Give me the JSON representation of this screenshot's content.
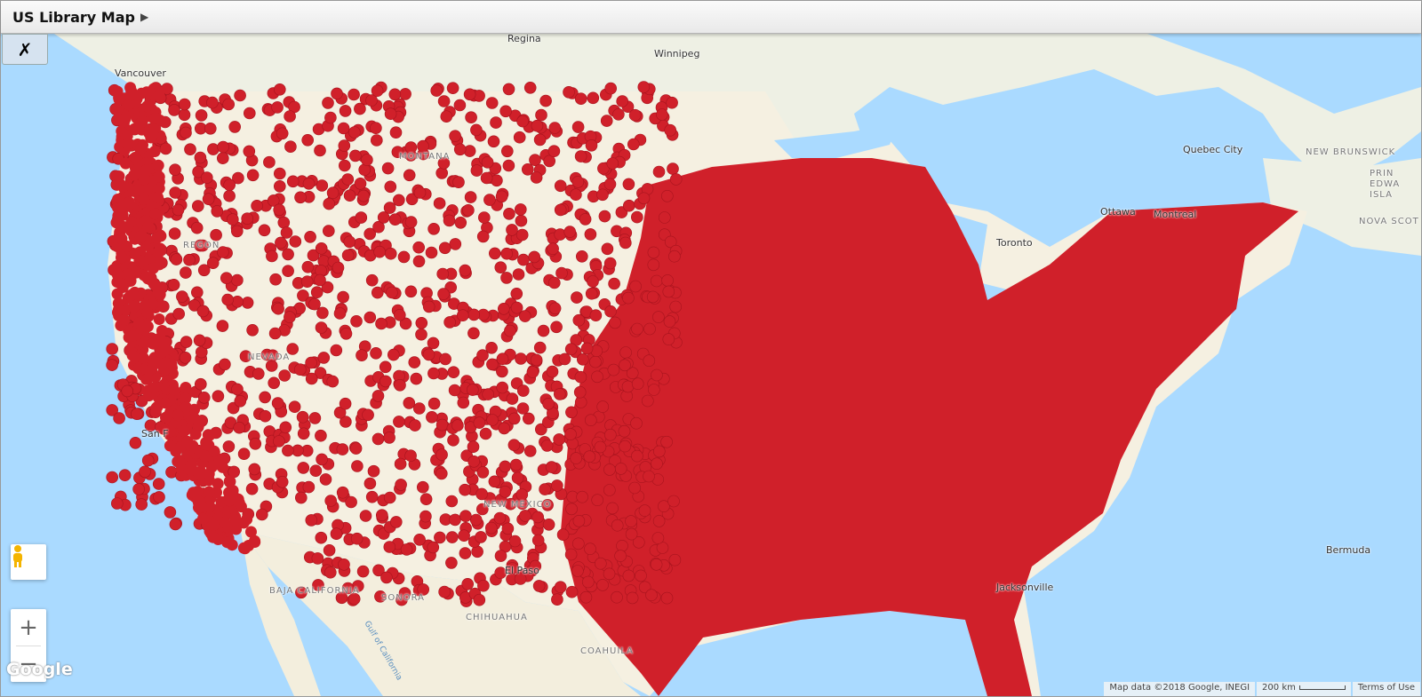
{
  "header": {
    "title": "US Library Map",
    "arrow_icon": "play-arrow-icon"
  },
  "toolbar": {
    "tools_icon": "wrench-screwdriver-icon"
  },
  "map": {
    "marker_color": "#d0202a",
    "labels": {
      "vancouver": "Vancouver",
      "regina": "Regina",
      "winnipeg": "Winnipeg",
      "quebec": "Quebec City",
      "montreal": "Montreal",
      "ottawa": "Ottawa",
      "toronto": "Toronto",
      "new_brunswick": "NEW BRUNSWICK",
      "nova_scotia": "NOVA SCOT",
      "pei": "PRIN",
      "edward": "EDWA",
      "isla": "ISLA",
      "bermuda": "Bermuda",
      "baja": "BAJA CALIFORNIA",
      "sonora": "SONORA",
      "chihuahua": "CHIHUAHUA",
      "coahuila": "COAHUILA",
      "gulf_ca": "Gulf of California",
      "montana": "MONTANA",
      "oregon": "REGON",
      "nevada": "NEVADA",
      "new_mexico": "NEW MEXICO",
      "el_paso": "El Paso",
      "san_f": "San F",
      "jacksonville": "Jacksonville"
    },
    "controls": {
      "zoom_in": "+",
      "zoom_out": "−",
      "pegman_icon": "pegman-icon"
    },
    "google_logo": "Google",
    "attribution": {
      "map_data": "Map data ©2018 Google, INEGI",
      "scale": "200 km",
      "terms": "Terms of Use"
    }
  }
}
